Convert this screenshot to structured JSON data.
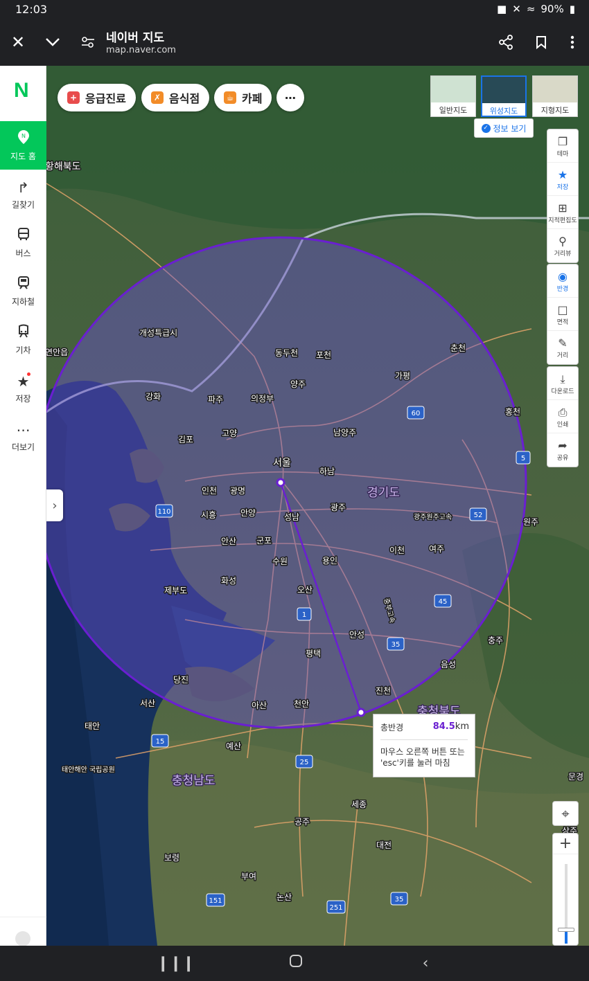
{
  "status_bar": {
    "time": "12:03",
    "battery": "90%"
  },
  "browser": {
    "title": "네이버 지도",
    "url": "map.naver.com"
  },
  "sidebar": {
    "logo": "N",
    "items": [
      {
        "label": "지도 홈",
        "icon": "map-pin-icon",
        "active": true
      },
      {
        "label": "길찾기",
        "icon": "turn-right-arrow-icon"
      },
      {
        "label": "버스",
        "icon": "bus-icon"
      },
      {
        "label": "지하철",
        "icon": "subway-icon"
      },
      {
        "label": "기차",
        "icon": "train-icon"
      },
      {
        "label": "저장",
        "icon": "star-icon"
      },
      {
        "label": "더보기",
        "icon": "more-dots-icon"
      }
    ]
  },
  "chips": [
    {
      "label": "응급진료",
      "color": "#e84c4c"
    },
    {
      "label": "음식점",
      "color": "#f28c28"
    },
    {
      "label": "카페",
      "color": "#f28c28"
    }
  ],
  "map_types": [
    {
      "label": "일반지도"
    },
    {
      "label": "위성지도",
      "active": true
    },
    {
      "label": "지형지도"
    }
  ],
  "info_button": "정보 보기",
  "tools_top": [
    {
      "label": "테마",
      "icon": "layers-icon"
    },
    {
      "label": "저장",
      "icon": "star-icon",
      "active": true
    },
    {
      "label": "지적편집도",
      "icon": "grid-icon"
    },
    {
      "label": "거리뷰",
      "icon": "location-pin-icon"
    }
  ],
  "tools_measure": [
    {
      "label": "반경",
      "icon": "radius-icon",
      "active": true
    },
    {
      "label": "면적",
      "icon": "area-icon"
    },
    {
      "label": "거리",
      "icon": "ruler-icon"
    }
  ],
  "tools_bottom": [
    {
      "label": "다운로드",
      "icon": "download-icon"
    },
    {
      "label": "인쇄",
      "icon": "printer-icon"
    },
    {
      "label": "공유",
      "icon": "share-icon"
    }
  ],
  "zoom": {
    "plus": "+",
    "level": 0.17
  },
  "measurement": {
    "label": "총반경",
    "value": "84.5",
    "unit": "km",
    "hint": "마우스 오른쪽 버튼 또는 'esc'키를 눌러 마침"
  },
  "colors": {
    "accent_green": "#03c75a",
    "radius_purple": "#6a1fd1",
    "active_blue": "#1a73e8"
  },
  "map_labels": {
    "cities": [
      "황해북도",
      "개성특급시",
      "연안읍",
      "동두천",
      "포천",
      "춘천",
      "가평",
      "강화",
      "파주",
      "의정부",
      "양주",
      "홍천",
      "김포",
      "고양",
      "남양주",
      "서울",
      "하남",
      "인천",
      "광명",
      "경기도",
      "시흥",
      "안양",
      "성남",
      "광주",
      "원주",
      "안산",
      "군포",
      "수원",
      "용인",
      "이천",
      "여주",
      "제부도",
      "화성",
      "오산",
      "충주",
      "안성",
      "평택",
      "음성",
      "당진",
      "서산",
      "아산",
      "천안",
      "진천",
      "태안",
      "예산",
      "충청북도",
      "충청남도",
      "세종",
      "공주",
      "대전",
      "보령",
      "부여",
      "논산",
      "태안해안 국립공원",
      "문경",
      "상주"
    ],
    "route_shields": [
      "110",
      "60",
      "52",
      "5",
      "1",
      "45",
      "35",
      "15",
      "25",
      "151",
      "251",
      "35"
    ],
    "highway_labels": [
      "광주원주고속",
      "중부고속"
    ]
  }
}
